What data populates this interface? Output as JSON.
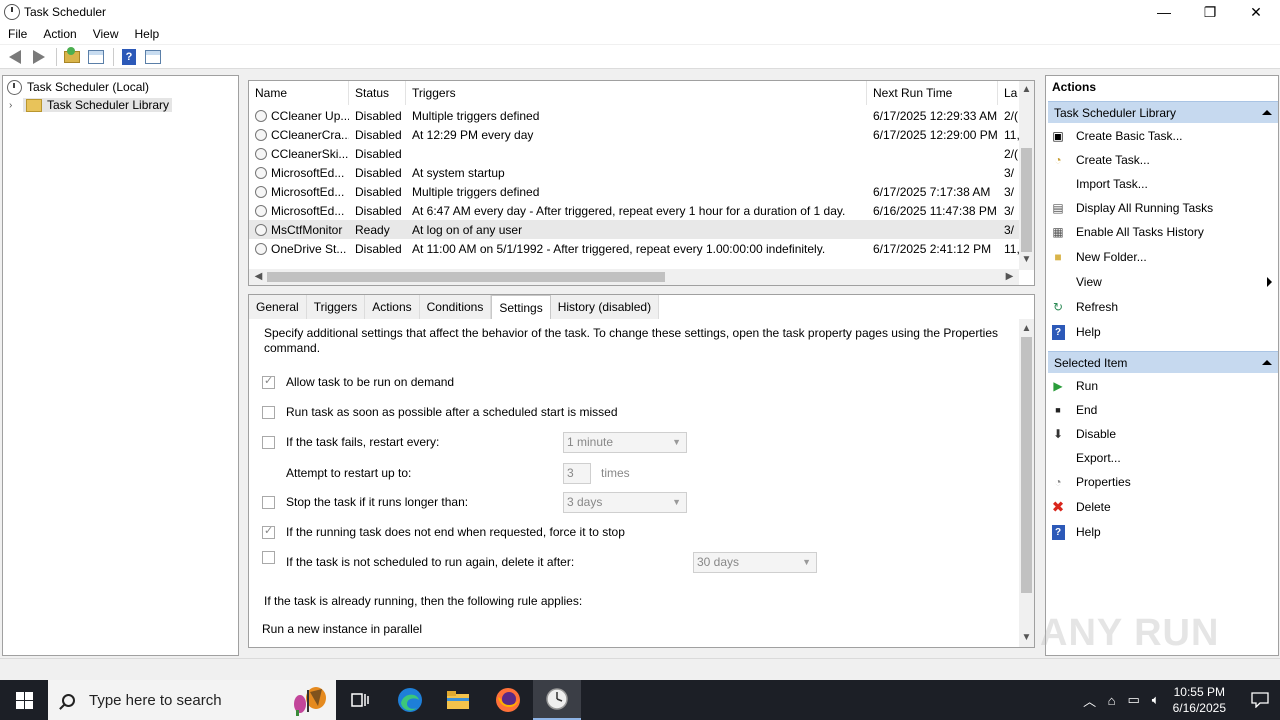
{
  "window": {
    "title": "Task Scheduler",
    "min": "—",
    "max": "❐",
    "close": "✕"
  },
  "menu": [
    "File",
    "Action",
    "View",
    "Help"
  ],
  "tree": {
    "root": "Task Scheduler (Local)",
    "library": "Task Scheduler Library"
  },
  "task_list": {
    "columns": [
      "Name",
      "Status",
      "Triggers",
      "Next Run Time",
      "La"
    ],
    "rows": [
      {
        "name": "CCleaner Up...",
        "status": "Disabled",
        "triggers": "Multiple triggers defined",
        "next": "6/17/2025 12:29:33 AM",
        "last": "2/("
      },
      {
        "name": "CCleanerCra...",
        "status": "Disabled",
        "triggers": "At 12:29 PM every day",
        "next": "6/17/2025 12:29:00 PM",
        "last": "11,"
      },
      {
        "name": "CCleanerSki...",
        "status": "Disabled",
        "triggers": "",
        "next": "",
        "last": "2/("
      },
      {
        "name": "MicrosoftEd...",
        "status": "Disabled",
        "triggers": "At system startup",
        "next": "",
        "last": "3/"
      },
      {
        "name": "MicrosoftEd...",
        "status": "Disabled",
        "triggers": "Multiple triggers defined",
        "next": "6/17/2025 7:17:38 AM",
        "last": "3/"
      },
      {
        "name": "MicrosoftEd...",
        "status": "Disabled",
        "triggers": "At 6:47 AM every day - After triggered, repeat every 1 hour for a duration of 1 day.",
        "next": "6/16/2025 11:47:38 PM",
        "last": "3/"
      },
      {
        "name": "MsCtfMonitor",
        "status": "Ready",
        "triggers": "At log on of any user",
        "next": "",
        "last": "3/"
      },
      {
        "name": "OneDrive St...",
        "status": "Disabled",
        "triggers": "At 11:00 AM on 5/1/1992 - After triggered, repeat every 1.00:00:00 indefinitely.",
        "next": "6/17/2025 2:41:12 PM",
        "last": "11,"
      }
    ]
  },
  "details": {
    "tabs": [
      "General",
      "Triggers",
      "Actions",
      "Conditions",
      "Settings",
      "History (disabled)"
    ],
    "description": "Specify additional settings that affect the behavior of the task. To change these settings, open the task property pages using the Properties command.",
    "opt_run_on_demand": "Allow task to be run on demand",
    "opt_run_asap": "Run task as soon as possible after a scheduled start is missed",
    "opt_restart": "If the task fails, restart every:",
    "restart_value": "1 minute",
    "attempt_label": "Attempt to restart up to:",
    "attempt_value": "3",
    "attempt_unit": "times",
    "opt_stop_longer": "Stop the task if it runs longer than:",
    "stop_value": "3 days",
    "opt_force_stop": "If the running task does not end when requested, force it to stop",
    "opt_delete": "If the task is not scheduled to run again, delete it after:",
    "delete_value": "30 days",
    "rule_label": "If the task is already running, then the following rule applies:",
    "rule_value": "Run a new instance in parallel"
  },
  "actions": {
    "title": "Actions",
    "section1": "Task Scheduler Library",
    "section1_items": [
      "Create Basic Task...",
      "Create Task...",
      "Import Task...",
      "Display All Running Tasks",
      "Enable All Tasks History",
      "New Folder...",
      "View",
      "Refresh",
      "Help"
    ],
    "section2": "Selected Item",
    "section2_items": [
      "Run",
      "End",
      "Disable",
      "Export...",
      "Properties",
      "Delete",
      "Help"
    ]
  },
  "taskbar": {
    "search_placeholder": "Type here to search",
    "time": "10:55 PM",
    "date": "6/16/2025"
  },
  "watermark": "ANY RUN"
}
